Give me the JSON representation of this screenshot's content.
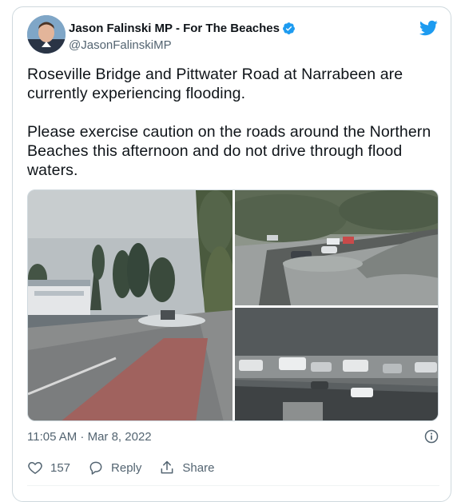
{
  "tweet": {
    "author_name": "Jason Falinski MP - For The Beaches",
    "handle": "@JasonFalinskiMP",
    "text": "Roseville Bridge and Pittwater Road at Narrabeen are currently experiencing flooding.\n\nPlease exercise caution on the roads around the Northern Beaches this afternoon and do not drive through flood waters.",
    "timestamp": "11:05 AM · Mar 8, 2022",
    "like_count": "157",
    "reply_label": "Reply",
    "share_label": "Share"
  },
  "colors": {
    "brand_blue": "#1d9bf0",
    "secondary_text": "#536471",
    "border": "#cfd9de"
  },
  "icons": [
    "twitter-bird-icon",
    "verified-badge-icon",
    "info-icon",
    "heart-icon",
    "reply-icon",
    "share-icon"
  ]
}
